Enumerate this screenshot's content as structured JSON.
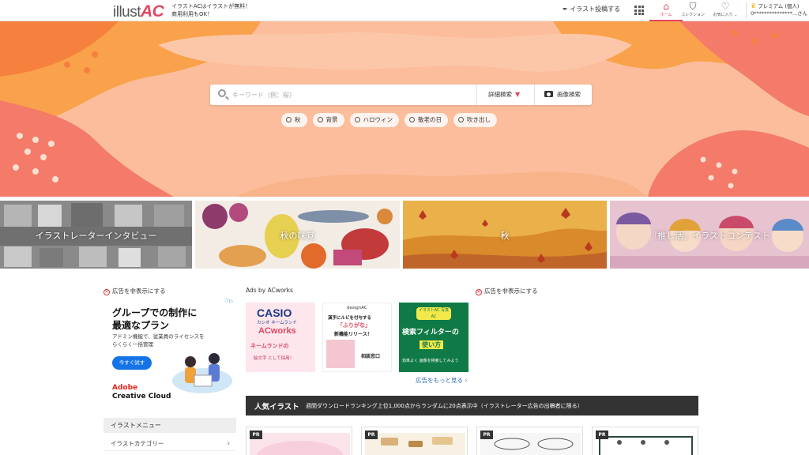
{
  "header": {
    "logo_text": "illust",
    "logo_accent": "AC",
    "tagline_1": "イラストACはイラストが無料！",
    "tagline_2": "商用利用もOK！",
    "upload_label": "イラスト投稿する",
    "nav": [
      {
        "label": "ホーム",
        "icon": "home-icon"
      },
      {
        "label": "コレクション",
        "icon": "bookmark-icon"
      },
      {
        "label": "お気に入り",
        "icon": "heart-icon"
      }
    ],
    "premium_label": "プレミアム (個人)",
    "user_name": "0***************...さん"
  },
  "search": {
    "placeholder": "キーワード（例：桜）",
    "advanced_label": "詳細検索",
    "image_search_label": "画像検索",
    "tags": [
      "秋",
      "背景",
      "ハロウィン",
      "敬老の日",
      "吹き出し"
    ]
  },
  "banners": [
    {
      "label": "イラストレーターインタビュー"
    },
    {
      "label": "秋の味覚"
    },
    {
      "label": "秋"
    },
    {
      "label": "『推し活』イラストコンテスト"
    }
  ],
  "ads": {
    "hide_ad_label": "広告を非表示にする",
    "ads_by_label": "Ads by ACworks",
    "more_ads_label": "広告をもっと見る ›",
    "adobe": {
      "title_1": "グループでの制作に",
      "title_2": "最適なプラン",
      "sub_1": "アドミン機能で、従業員のライセンスを",
      "sub_2": "らくらく一括管理",
      "button": "今すぐ試す",
      "brand_1": "Adobe",
      "brand_2": "Creative Cloud"
    },
    "casio": {
      "brand": "CASIO",
      "line1": "カシオ ネームランド",
      "ac": "ACworks",
      "line2": "ネームランドの",
      "line3": "絵文字 として採用！"
    },
    "design": {
      "logo": "designAC",
      "line1": "漢字にルビを付与する",
      "line2": "「ふりがな」",
      "line3": "新機能リリース！",
      "line4": "相談窓口"
    },
    "filter": {
      "badge": "イラストAC 写真AC",
      "line1": "検索フィルターの",
      "line2": "使い方",
      "line3": "効率よく 画像を検索してみよう"
    }
  },
  "popular": {
    "title": "人気イラスト",
    "desc": "週間ダウンロードランキング上位1,000点からランダムに20点表示中（イラストレーター広告の出稿者に限る）"
  },
  "sidebar": {
    "menu_title": "イラストメニュー",
    "item_1": "イラストカテゴリー"
  },
  "cards": [
    {
      "badge": "PR"
    },
    {
      "badge": "PR"
    },
    {
      "badge": "PR"
    },
    {
      "badge": "PR"
    }
  ],
  "colors": {
    "accent": "#e0475f",
    "hero_bg": "#fbbd9b",
    "popular_bar": "#333333"
  }
}
